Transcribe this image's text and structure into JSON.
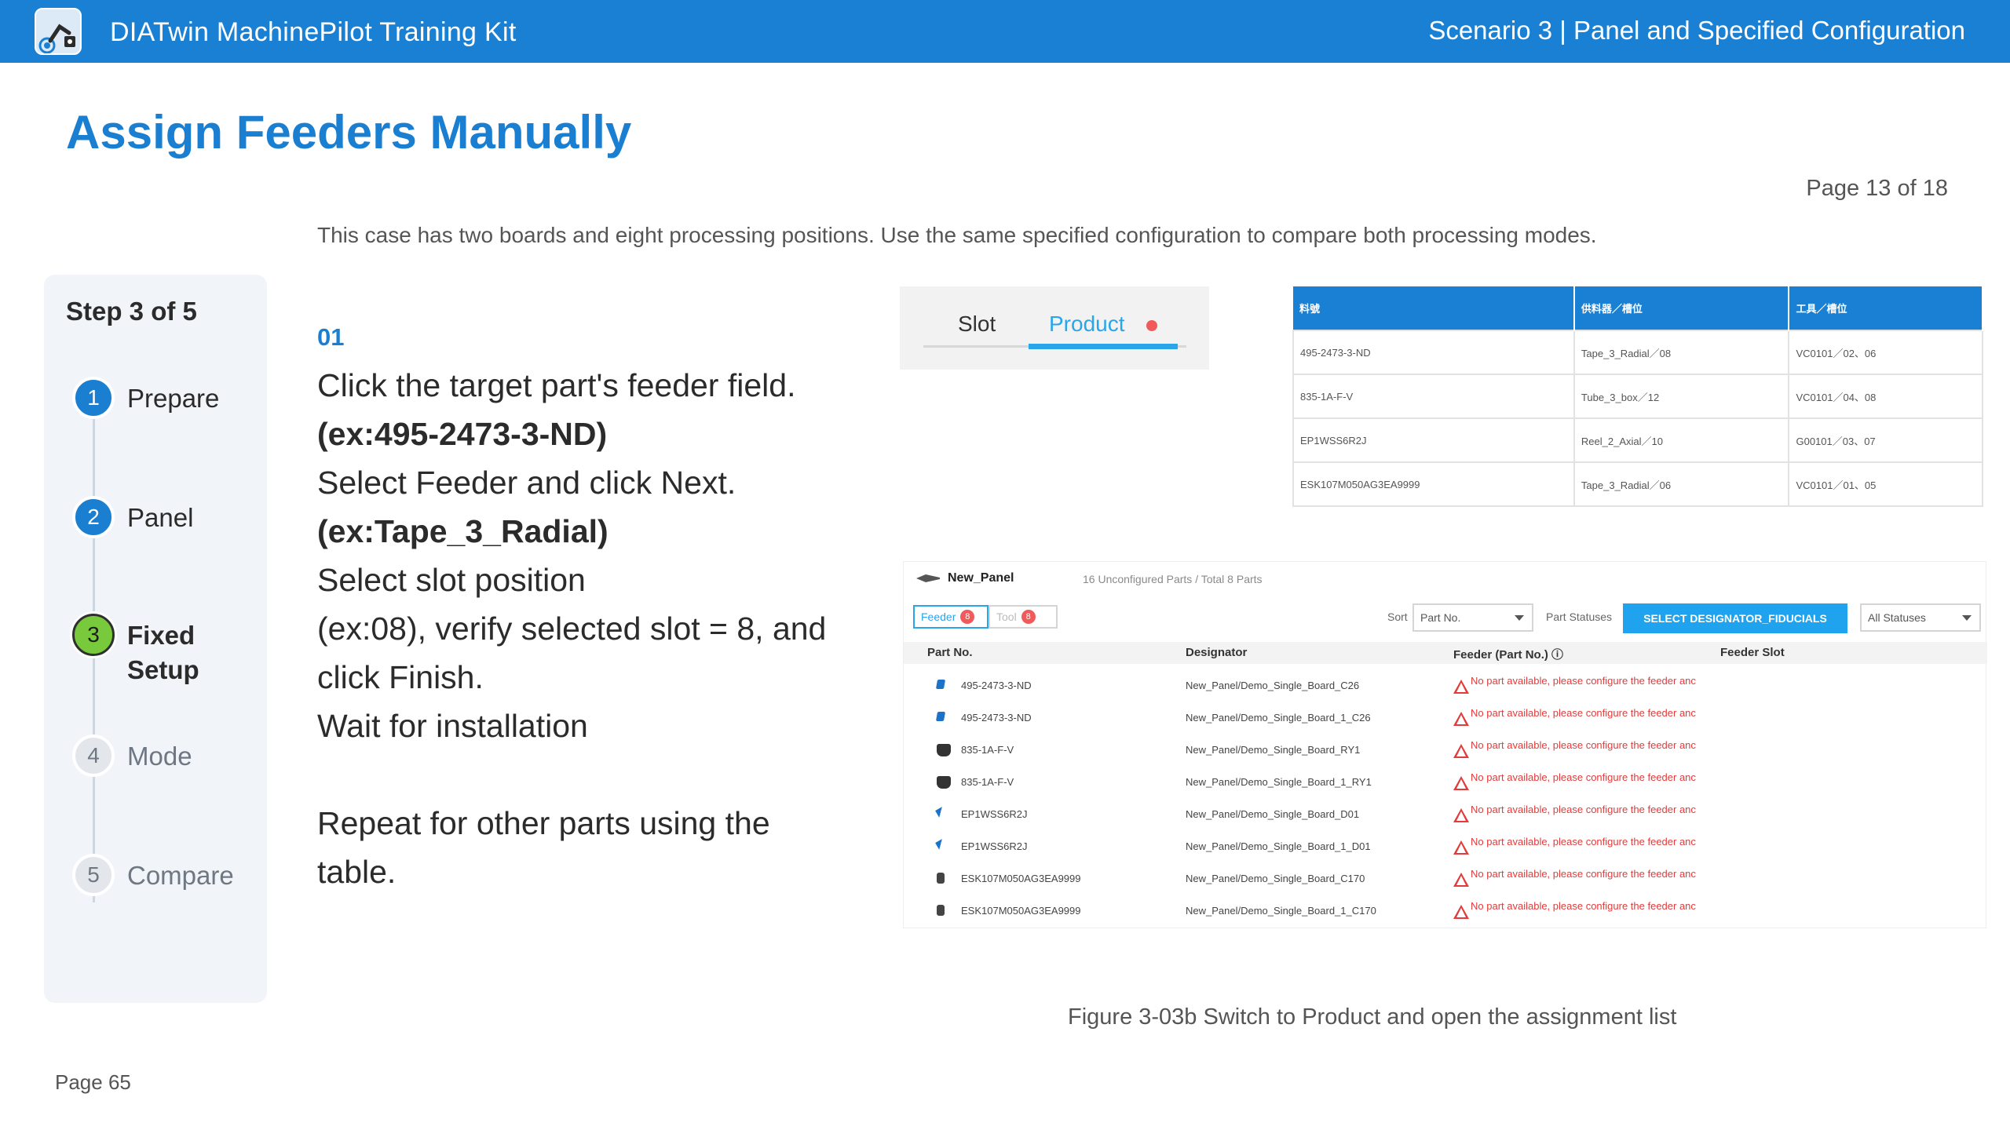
{
  "header": {
    "app_title": "DIATwin MachinePilot Training Kit",
    "scenario": "Scenario 3 | Panel and Specified Configuration",
    "logo_icon": "robot-arm-logo-icon",
    "brand_color": "#1a80d4"
  },
  "page": {
    "heading": "Assign Feeders Manually",
    "counter": "Page 13 of 18",
    "intro": "This case has two boards and eight processing positions. Use the same specified configuration to compare both processing modes.",
    "footer": "Page 65"
  },
  "stepper": {
    "title": "Step 3 of 5",
    "steps": [
      {
        "num": "1",
        "label": "Prepare",
        "state": "done"
      },
      {
        "num": "2",
        "label": "Panel",
        "state": "done"
      },
      {
        "num": "3",
        "label_line1": "Fixed",
        "label_line2": "Setup",
        "state": "active"
      },
      {
        "num": "4",
        "label": "Mode",
        "state": "todo"
      },
      {
        "num": "5",
        "label": "Compare",
        "state": "todo"
      }
    ]
  },
  "instructions": {
    "number": "01",
    "lines": [
      "Click the target part's feeder field.",
      "(ex:495-2473-3-ND)",
      "Select Feeder and click Next.",
      "(ex:Tape_3_Radial)",
      "Select slot position",
      "(ex:08), verify selected slot = 8, and",
      "click Finish.",
      "Wait for installation",
      "Repeat for other parts using the",
      "table."
    ]
  },
  "toggle_shot": {
    "slot_label": "Slot",
    "product_label": "Product"
  },
  "ref_table": {
    "headers": [
      "料號",
      "供料器／槽位",
      "工具／槽位"
    ],
    "rows": [
      [
        "495-2473-3-ND",
        "Tape_3_Radial／08",
        "VC0101／02、06"
      ],
      [
        "835-1A-F-V",
        "Tube_3_box／12",
        "VC0101／04、08"
      ],
      [
        "EP1WSS6R2J",
        "Reel_2_Axial／10",
        "G00101／03、07"
      ],
      [
        "ESK107M050AG3EA9999",
        "Tape_3_Radial／06",
        "VC0101／01、05"
      ]
    ]
  },
  "list_shot": {
    "panel_name": "New_Panel",
    "summary": "16 Unconfigured Parts / Total 8 Parts",
    "feeder_tab": "Feeder",
    "feeder_badge": "8",
    "tool_tab": "Tool",
    "tool_badge": "8",
    "sort_label": "Sort",
    "sort_value": "Part No.",
    "status_label": "Part Statuses",
    "cta_label": "SELECT DESIGNATOR_FIDUCIALS",
    "status_value": "All Statuses",
    "columns": [
      "Part No.",
      "Designator",
      "Feeder (Part No.) ⓘ",
      "Feeder Slot"
    ],
    "error_text": "No part available, please configure the feeder anc",
    "rows": [
      {
        "icon": "blue",
        "part": "495-2473-3-ND",
        "designator": "New_Panel/Demo_Single_Board_C26"
      },
      {
        "icon": "blue",
        "part": "495-2473-3-ND",
        "designator": "New_Panel/Demo_Single_Board_1_C26"
      },
      {
        "icon": "dark",
        "part": "835-1A-F-V",
        "designator": "New_Panel/Demo_Single_Board_RY1"
      },
      {
        "icon": "dark",
        "part": "835-1A-F-V",
        "designator": "New_Panel/Demo_Single_Board_1_RY1"
      },
      {
        "icon": "pin",
        "part": "EP1WSS6R2J",
        "designator": "New_Panel/Demo_Single_Board_D01"
      },
      {
        "icon": "pin",
        "part": "EP1WSS6R2J",
        "designator": "New_Panel/Demo_Single_Board_1_D01"
      },
      {
        "icon": "cap",
        "part": "ESK107M050AG3EA9999",
        "designator": "New_Panel/Demo_Single_Board_C170"
      },
      {
        "icon": "cap",
        "part": "ESK107M050AG3EA9999",
        "designator": "New_Panel/Demo_Single_Board_1_C170"
      }
    ]
  },
  "caption": "Figure 3-03b  Switch to Product and open the assignment list"
}
